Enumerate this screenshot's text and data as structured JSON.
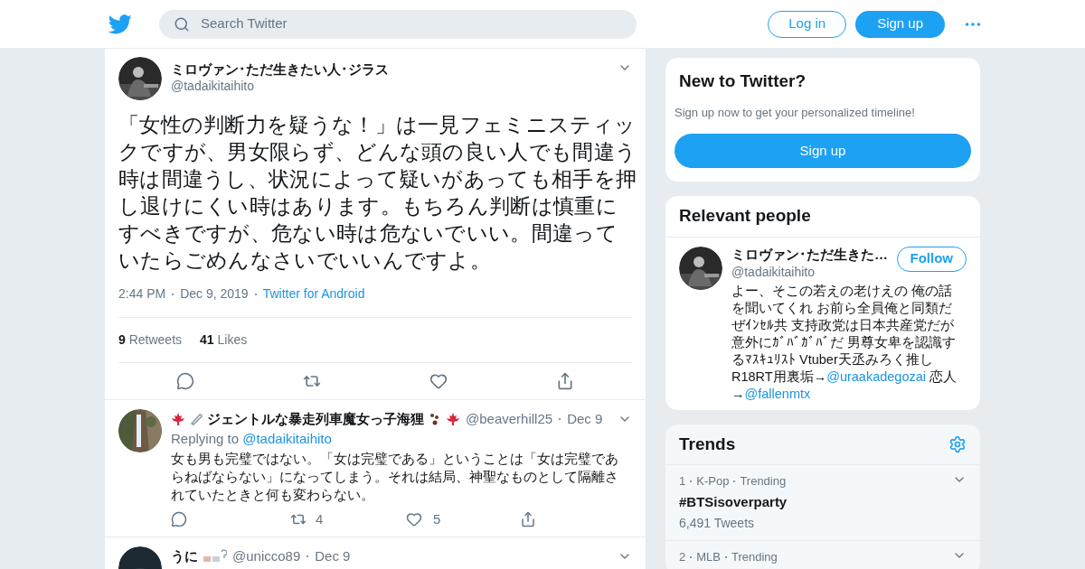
{
  "header": {
    "search": {
      "placeholder": "Search Twitter"
    },
    "login": "Log in",
    "signup": "Sign up"
  },
  "tweet": {
    "name": "ミロヴァン･ただ生きたい人･ジラス",
    "handle": "@tadaikitaihito",
    "text": "「女性の判断力を疑うな！」は一見フェミニスティックですが、男女限らず、どんな頭の良い人でも間違う時は間違うし、状況によって疑いがあっても相手を押し退けにくい時はあります。もちろん判断は慎重にすべきですが、危ない時は危ないでいい。間違っていたらごめんなさいでいいんですよ。",
    "time": "2:44 PM",
    "date": "Dec 9, 2019",
    "source": "Twitter for Android",
    "stats": [
      {
        "count": "9",
        "label": "Retweets"
      },
      {
        "count": "41",
        "label": "Likes"
      }
    ]
  },
  "replies": [
    {
      "name": "ジェントルな暴走列車魔女っ子海狸",
      "handle": "@beaverhill25",
      "date": "Dec 9",
      "replying_label": "Replying to",
      "replying_to": "@tadaikitaihito",
      "text": "女も男も完璧ではない。「女は完璧である」ということは「女は完璧であらねばならない」になってしまう。それは結局、神聖なものとして隔離されていたときと何も変わらない。",
      "retweets": "4",
      "likes": "5"
    },
    {
      "name": "うに",
      "handle": "@unicco89",
      "date": "Dec 9"
    }
  ],
  "new_to_twitter": {
    "title": "New to Twitter?",
    "text": "Sign up now to get your personalized timeline!",
    "button": "Sign up"
  },
  "relevant_people": {
    "title": "Relevant people",
    "name": "ミロヴァン･ただ生きた…",
    "handle": "@tadaikitaihito",
    "follow": "Follow",
    "bio": [
      {
        "kind": "text",
        "text": "よー、そこの若えの老けえの 俺の話を聞いてくれ お前ら全員俺と同類だぜｲﾝｾﾙ共 支持政党は日本共産党だが意外にｶﾞﾊﾞｶﾞﾊﾞだ 男尊女卑を認識するﾏｽｷｭﾘｽﾄ Vtuber天丞みろく推し R18RT用裏垢→"
      },
      {
        "kind": "link",
        "text": "@uraakadegozai"
      },
      {
        "kind": "text",
        "text": " 恋人→"
      },
      {
        "kind": "link",
        "text": "@fallenmtx"
      }
    ]
  },
  "trends": {
    "title": "Trends",
    "items": [
      {
        "rank": "1",
        "category": "K-Pop",
        "status": "Trending",
        "name": "#BTSisoverparty",
        "count": "6,491 Tweets"
      },
      {
        "rank": "2",
        "category": "MLB",
        "status": "Trending"
      }
    ]
  }
}
